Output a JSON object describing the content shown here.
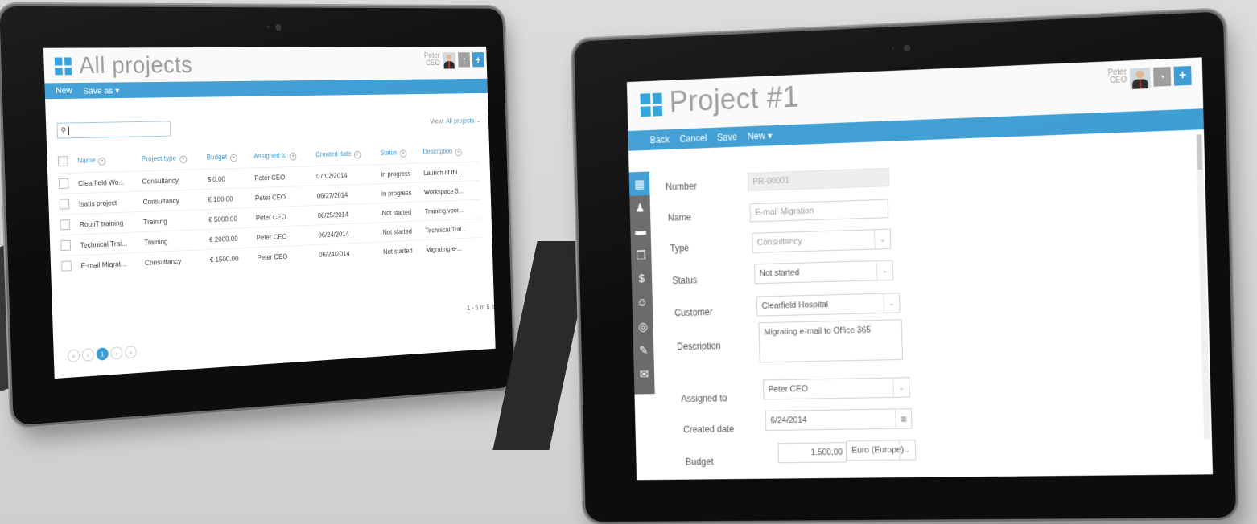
{
  "list_screen": {
    "title": "All projects",
    "user": {
      "name": "Peter",
      "role": "CEO"
    },
    "header_buttons": {
      "timer_icon": "clock-icon",
      "add_label": "+"
    },
    "toolbar": {
      "new_label": "New",
      "save_as_label": "Save as ▾"
    },
    "search": {
      "placeholder": "",
      "icon": "search-icon"
    },
    "view": {
      "prefix": "View:",
      "value": "All projects ⌄"
    },
    "columns": [
      "Name",
      "Project type",
      "Budget",
      "Assigned to",
      "Created date",
      "Status",
      "Description"
    ],
    "rows": [
      [
        "Clearfield Wo...",
        "Consultancy",
        "$ 0.00",
        "Peter CEO",
        "07/02/2014",
        "In progress",
        "Launch of thi..."
      ],
      [
        "Isatis project",
        "Consultancy",
        "€ 100.00",
        "Peter CEO",
        "06/27/2014",
        "In progress",
        "Workspace 3..."
      ],
      [
        "RoutiT training",
        "Training",
        "€ 5000.00",
        "Peter CEO",
        "06/25/2014",
        "Not started",
        "Training voor..."
      ],
      [
        "Technical Trai...",
        "Training",
        "€ 2000.00",
        "Peter CEO",
        "06/24/2014",
        "Not started",
        "Technical Trai..."
      ],
      [
        "E-mail Migrat...",
        "Consultancy",
        "€ 1500.00",
        "Peter CEO",
        "06/24/2014",
        "Not started",
        "Migrating e-..."
      ]
    ],
    "pagination": {
      "first": "«",
      "prev": "‹",
      "current": "1",
      "next": "›",
      "last": "»",
      "count": "1 - 5 of 5 it"
    }
  },
  "form_screen": {
    "title": "Project #1",
    "user": {
      "name": "Peter",
      "role": "CEO"
    },
    "header_buttons": {
      "timer_icon": "clock-icon",
      "add_label": "+"
    },
    "toolbar": {
      "back_label": "Back",
      "cancel_label": "Cancel",
      "save_label": "Save",
      "new_label": "New ▾"
    },
    "side_rail": [
      {
        "icon": "dashboard-icon",
        "glyph": "▦"
      },
      {
        "icon": "people-icon",
        "glyph": "👥"
      },
      {
        "icon": "folder-icon",
        "glyph": "▬"
      },
      {
        "icon": "document-icon",
        "glyph": "❐"
      },
      {
        "icon": "money-icon",
        "glyph": "$"
      },
      {
        "icon": "user-icon",
        "glyph": "☺"
      },
      {
        "icon": "gauge-icon",
        "glyph": "◎"
      },
      {
        "icon": "ticket-icon",
        "glyph": "✉"
      },
      {
        "icon": "mail-icon",
        "glyph": "✉"
      }
    ],
    "fields": {
      "number": {
        "label": "Number",
        "value": "PR-00001"
      },
      "name": {
        "label": "Name",
        "value": "E-mail Migration"
      },
      "type": {
        "label": "Type",
        "value": "Consultancy"
      },
      "status": {
        "label": "Status",
        "value": "Not started"
      },
      "customer": {
        "label": "Customer",
        "value": "Clearfield Hospital"
      },
      "description": {
        "label": "Description",
        "value": "Migrating e-mail to Office 365"
      },
      "assigned_to": {
        "label": "Assigned to",
        "value": "Peter CEO"
      },
      "created_date": {
        "label": "Created date",
        "value": "6/24/2014"
      },
      "budget": {
        "label": "Budget",
        "value": "1.500,00",
        "currency": "Euro (Europe)"
      }
    }
  },
  "colors": {
    "accent": "#3d9dd3",
    "bezel": "#0d0d0d",
    "background": "#d6d6d6"
  }
}
